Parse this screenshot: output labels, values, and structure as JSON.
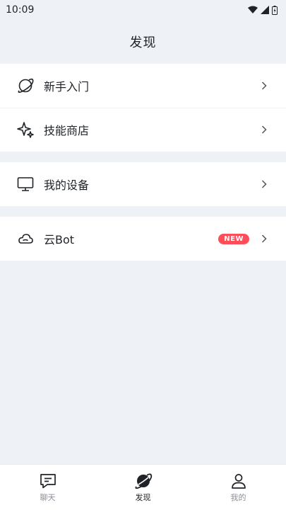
{
  "status_bar": {
    "time": "10:09"
  },
  "header": {
    "title": "发现"
  },
  "groups": [
    {
      "items": [
        {
          "label": "新手入门",
          "icon": "planet-outline-icon"
        },
        {
          "label": "技能商店",
          "icon": "sparkles-icon"
        }
      ]
    },
    {
      "items": [
        {
          "label": "我的设备",
          "icon": "monitor-icon"
        }
      ]
    },
    {
      "items": [
        {
          "label": "云Bot",
          "icon": "cloud-icon",
          "badge": "NEW"
        }
      ]
    }
  ],
  "tabbar": {
    "tabs": [
      {
        "label": "聊天",
        "icon": "chat-icon"
      },
      {
        "label": "发现",
        "icon": "planet-filled-icon",
        "active": true
      },
      {
        "label": "我的",
        "icon": "user-icon"
      }
    ]
  },
  "colors": {
    "background": "#eef2f6",
    "badge": "#ff4d5a",
    "text": "#1f2328",
    "inactive": "#8a8f98"
  }
}
